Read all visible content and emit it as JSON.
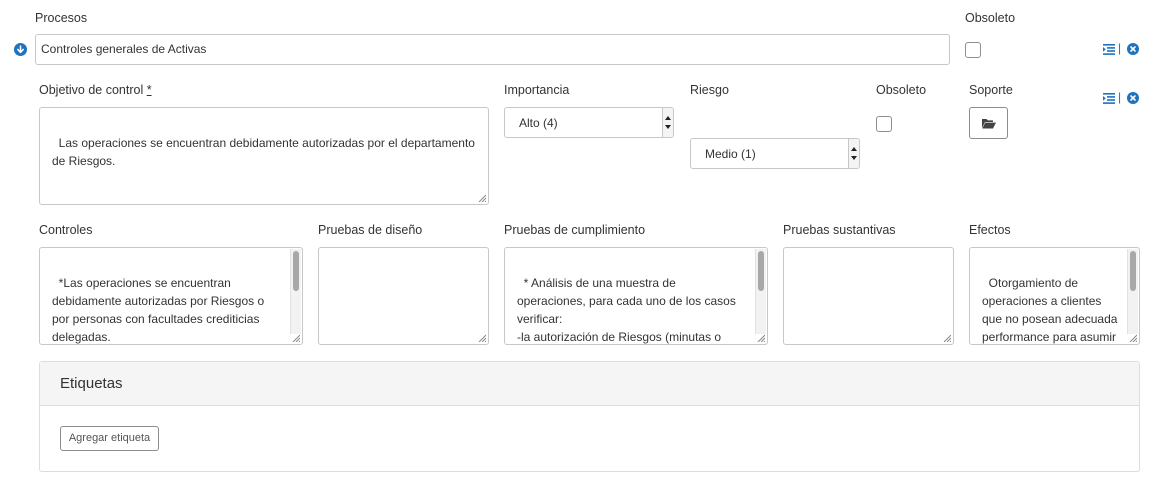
{
  "process": {
    "label": "Procesos",
    "value": "Controles generales de Activas",
    "obsolete_label": "Obsoleto"
  },
  "objective": {
    "label": "Objetivo de control",
    "required_mark": "*",
    "value": "Las operaciones se encuentran debidamente autorizadas por el departamento de Riesgos."
  },
  "importance": {
    "label": "Importancia",
    "selected": "Alto (4)"
  },
  "risk": {
    "label": "Riesgo",
    "selected": "Medio (1)"
  },
  "obsolete2": {
    "label": "Obsoleto"
  },
  "support": {
    "label": "Soporte"
  },
  "controls": {
    "label": "Controles",
    "value": "*Las operaciones se encuentran debidamente autorizadas por Riesgos o por personas con facultades crediticias delegadas.\n*Las excepciones en cuanto a"
  },
  "design_tests": {
    "label": "Pruebas de diseño",
    "value": ""
  },
  "compliance_tests": {
    "label": "Pruebas de cumplimiento",
    "value": "* Análisis de una muestra de operaciones, para cada uno de los casos verificar:\n-la autorización de Riesgos (minutas o preaprobaciones) o por personas con"
  },
  "substantive_tests": {
    "label": "Pruebas sustantivas",
    "value": ""
  },
  "effects": {
    "label": "Efectos",
    "value": "Otorgamiento de operaciones a clientes que no posean adecuada performance para asumir riesgos"
  },
  "tags": {
    "title": "Etiquetas",
    "add_button": "Agregar etiqueta"
  },
  "icons": {
    "separator": "|",
    "accent_color": "#1e73be"
  }
}
